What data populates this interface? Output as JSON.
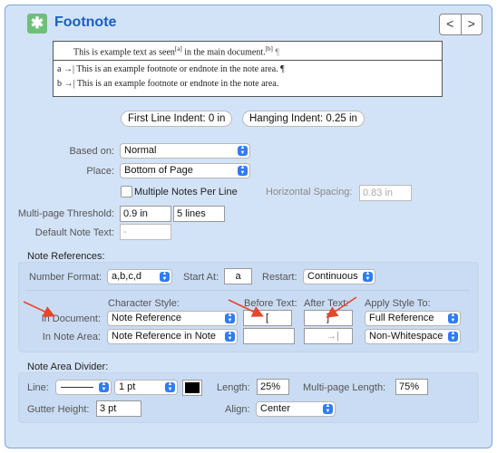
{
  "header": {
    "title": "Footnote",
    "icon": "asterisk-icon",
    "nav_prev": "<",
    "nav_next": ">"
  },
  "preview": {
    "main_text": "This is example text as seen",
    "marker_a": "[a]",
    "main_text_2": " in the main document.",
    "marker_b": "[b]",
    "pilcrow": "¶",
    "note_a": "a →| This is an example footnote or endnote in the note area. ¶",
    "note_b": "b →| This is an example footnote or endnote in the note area."
  },
  "indents": {
    "first_line": "First Line Indent: 0 in",
    "hanging": "Hanging Indent: 0.25 in"
  },
  "based_on": {
    "label": "Based on:",
    "value": "Normal"
  },
  "place": {
    "label": "Place:",
    "value": "Bottom of Page"
  },
  "multiple_notes": {
    "label": "Multiple Notes Per Line",
    "checked": false
  },
  "horizontal_spacing": {
    "label": "Horizontal Spacing:",
    "value": "0.83 in"
  },
  "multipage_threshold": {
    "label": "Multi-page Threshold:",
    "value": "0.9 in",
    "lines": "5 lines"
  },
  "default_note_text": {
    "label": "Default Note Text:",
    "value": "-"
  },
  "note_references": {
    "heading": "Note References:",
    "number_format_label": "Number Format:",
    "number_format": "a,b,c,d",
    "start_at_label": "Start At:",
    "start_at": "a",
    "restart_label": "Restart:",
    "restart": "Continuous",
    "col_character_style": "Character Style:",
    "col_before_text": "Before Text:",
    "col_after_text": "After Text:",
    "col_apply_style": "Apply Style To:",
    "in_document": {
      "label": "In Document:",
      "character_style": "Note Reference",
      "before_text": "[",
      "after_text": "]",
      "apply_style": "Full Reference"
    },
    "in_note_area": {
      "label": "In Note Area:",
      "character_style": "Note Reference in Note",
      "before_text": "",
      "after_text": "→|",
      "apply_style": "Non-Whitespace"
    }
  },
  "divider": {
    "heading": "Note Area Divider:",
    "line_label": "Line:",
    "line_weight": "1 pt",
    "color": "#000000",
    "length_label": "Length:",
    "length": "25%",
    "multipage_length_label": "Multi-page Length:",
    "multipage_length": "75%",
    "gutter_label": "Gutter Height:",
    "gutter": "3 pt",
    "align_label": "Align:",
    "align": "Center"
  },
  "colors": {
    "accent": "#2f7cf6",
    "title": "#1a5fc2",
    "annotation_arrow": "#e8452a"
  }
}
